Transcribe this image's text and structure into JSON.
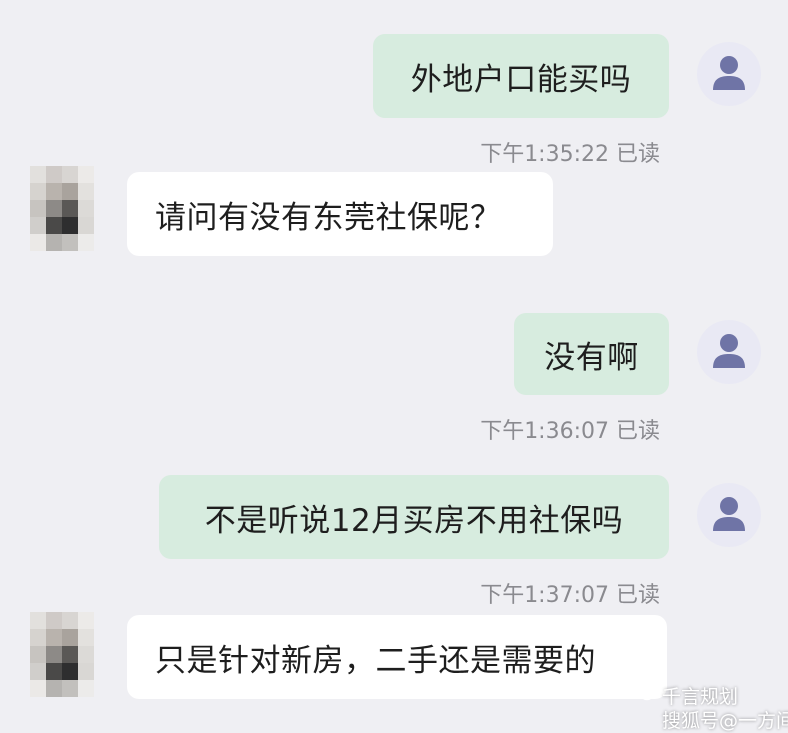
{
  "messages": [
    {
      "from": "me",
      "text": "外地户口能买吗",
      "time": "下午1:35:22 已读"
    },
    {
      "from": "them",
      "text": "请问有没有东莞社保呢？"
    },
    {
      "from": "me",
      "text": "没有啊",
      "time": "下午1:36:07 已读"
    },
    {
      "from": "me",
      "text": "不是听说12月买房不用社保吗",
      "time": "下午1:37:07 已读"
    },
    {
      "from": "them",
      "text": "只是针对新房，二手还是需要的"
    }
  ],
  "watermark": {
    "line1": "千言规划",
    "line2": "搜狐号@一方间"
  },
  "colors": {
    "background": "#efeff3",
    "my_bubble": "#d7ecdf",
    "their_bubble": "#ffffff",
    "avatar_icon": "#6f74a6"
  }
}
